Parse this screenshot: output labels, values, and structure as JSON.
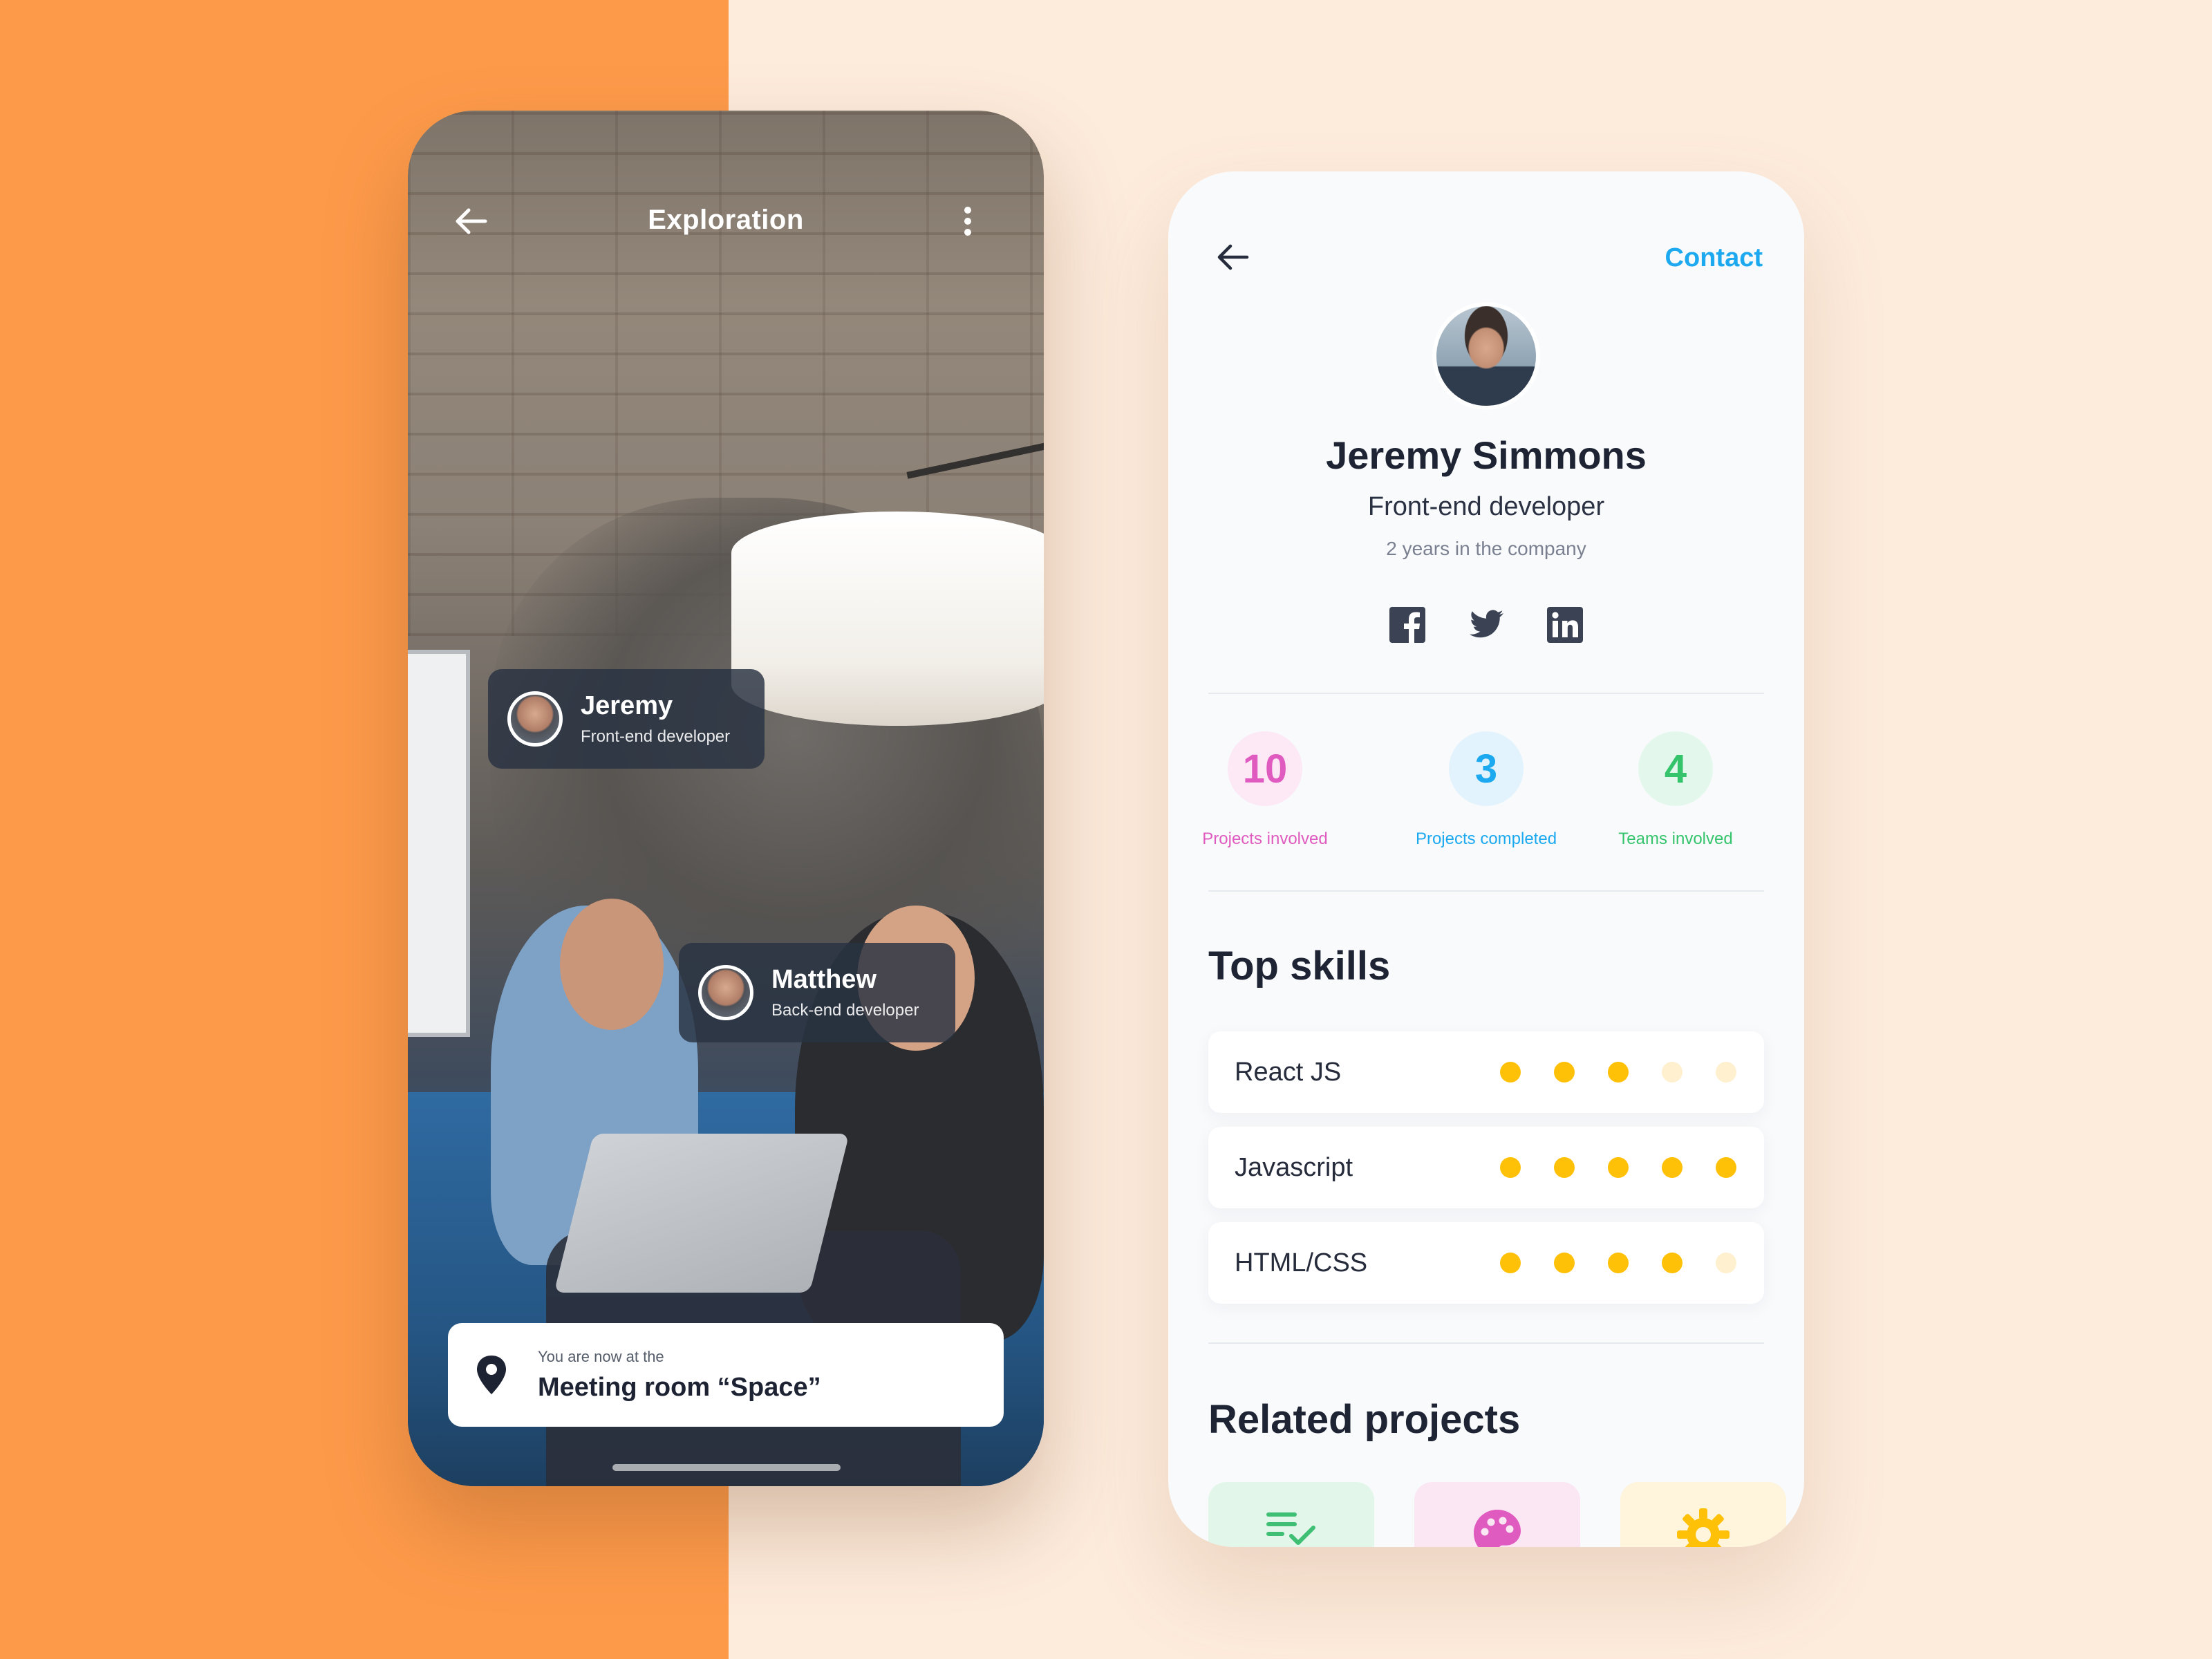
{
  "exploration": {
    "title": "Exploration",
    "people_tags": [
      {
        "name": "Jeremy",
        "role": "Front-end developer"
      },
      {
        "name": "Matthew",
        "role": "Back-end developer"
      }
    ],
    "location": {
      "caption": "You are now at the",
      "room": "Meeting room “Space”"
    }
  },
  "profile": {
    "contact_label": "Contact",
    "name": "Jeremy Simmons",
    "role": "Front-end developer",
    "tenure": "2 years in the company",
    "socials": [
      "facebook-icon",
      "twitter-icon",
      "linkedin-icon"
    ],
    "stats": [
      {
        "value": "10",
        "label": "Projects involved",
        "color": "#e05bbf",
        "bg": "#fde8f6"
      },
      {
        "value": "3",
        "label": "Projects completed",
        "color": "#1ca9f0",
        "bg": "#e3f3fd"
      },
      {
        "value": "4",
        "label": "Teams involved",
        "color": "#35c46c",
        "bg": "#e4f7ec"
      }
    ],
    "top_skills_title": "Top skills",
    "skills": [
      {
        "name": "React JS",
        "level": 3,
        "max": 5
      },
      {
        "name": "Javascript",
        "level": 5,
        "max": 5
      },
      {
        "name": "HTML/CSS",
        "level": 4,
        "max": 5
      }
    ],
    "related_projects_title": "Related projects",
    "related_projects_icons": [
      "task-list-icon",
      "palette-icon",
      "gear-icon"
    ]
  },
  "colors": {
    "accent_orange": "#fd9a4a",
    "accent_blue": "#1ca9f0",
    "skill_dot": "#ffc107",
    "avatar_ring": "#ffc107"
  }
}
